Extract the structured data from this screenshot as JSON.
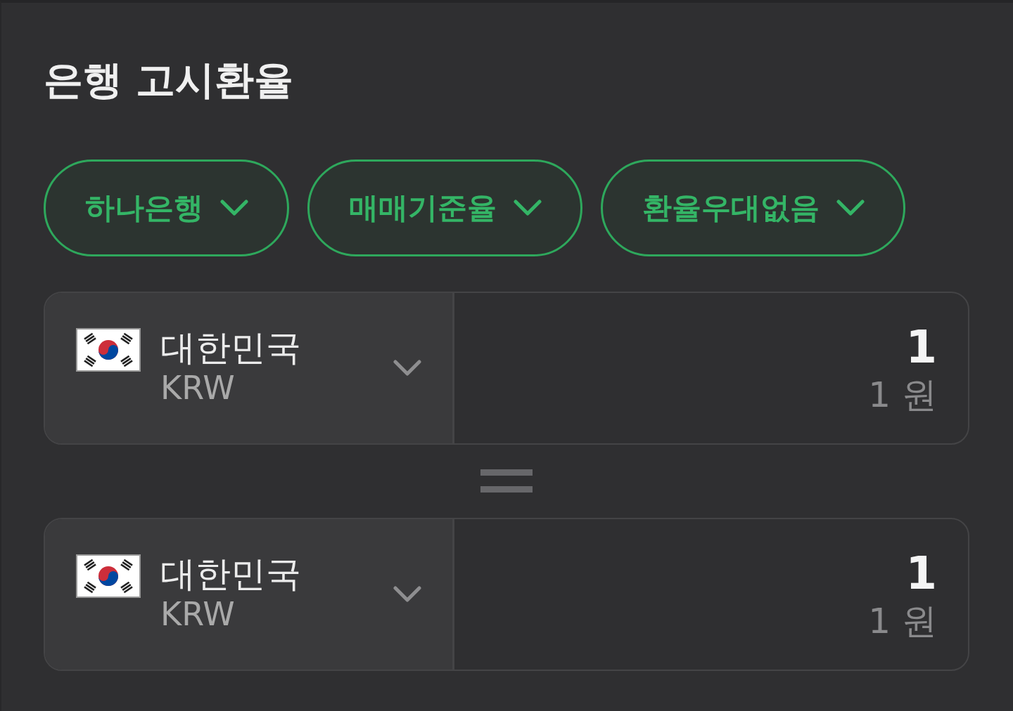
{
  "title": "은행 고시환율",
  "filters": [
    {
      "label": "하나은행"
    },
    {
      "label": "매매기준율"
    },
    {
      "label": "환율우대없음"
    }
  ],
  "converters": [
    {
      "country": "대한민국",
      "currency": "KRW",
      "amount": "1",
      "amount_words": "1 원"
    },
    {
      "country": "대한민국",
      "currency": "KRW",
      "amount": "1",
      "amount_words": "1 원"
    }
  ]
}
